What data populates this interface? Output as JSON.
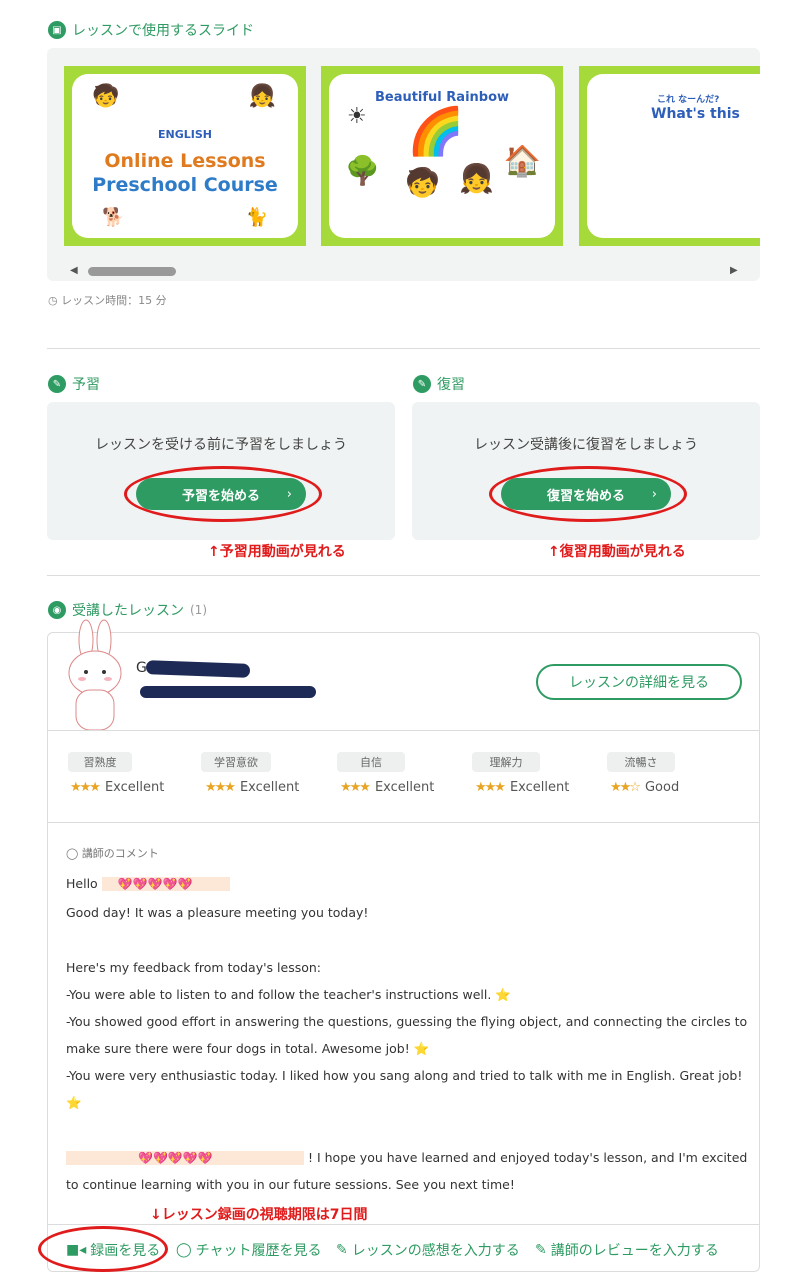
{
  "slides_section": {
    "title": "レッスンで使用するスライド",
    "slides": [
      {
        "line1": "ENGLISH",
        "line2": "Online Lessons",
        "line3": "Preschool Course"
      },
      {
        "line1": "Beautiful Rainbow"
      },
      {
        "line1": "これ なーんだ?",
        "line2": "What's this"
      }
    ],
    "lesson_time": "レッスン時間：15 分"
  },
  "preview": {
    "title": "予習",
    "message": "レッスンを受ける前に予習をしましょう",
    "button": "予習を始める",
    "annotation": "↑予習用動画が見れる"
  },
  "review": {
    "title": "復習",
    "message": "レッスン受講後に復習をしましょう",
    "button": "復習を始める",
    "annotation": "↑復習用動画が見れる"
  },
  "taken": {
    "title": "受講したレッスン",
    "count": "(1)",
    "teacher_initial": "G",
    "detail_button": "レッスンの詳細を見る",
    "metrics": [
      {
        "label": "習熟度",
        "stars": "★★★",
        "value": "Excellent"
      },
      {
        "label": "学習意欲",
        "stars": "★★★",
        "value": "Excellent"
      },
      {
        "label": "自信",
        "stars": "★★★",
        "value": "Excellent"
      },
      {
        "label": "理解力",
        "stars": "★★★",
        "value": "Excellent"
      },
      {
        "label": "流暢さ",
        "stars": "★★☆",
        "value": "Good"
      }
    ],
    "comment_header": "講師のコメント",
    "comment": {
      "hello": "Hello",
      "hearts": "💖💖💖💖💖",
      "line1": "Good day! It was a pleasure meeting you today!",
      "line2": "Here's my feedback from today's lesson:",
      "line3": "-You were able to listen to and follow the teacher's instructions well. ⭐",
      "line4a": "-You showed good effort in answering the questions, guessing the flying object, and connecting the circles to",
      "line4b": "make sure there were four dogs in total. Awesome job! ⭐",
      "line5a": "-You were very enthusiastic today. I liked how you sang along and tried to talk with me in English. Great job!",
      "line5b": "⭐",
      "line6a": "! I hope you have learned and enjoyed today's lesson, and I'm excited",
      "line6b": "to continue learning with you in our future sessions. See you next time!"
    },
    "recording_note": "↓レッスン録画の視聴期限は7日間",
    "actions": {
      "recording": "録画を見る",
      "chat": "チャット履歴を見る",
      "impression": "レッスンの感想を入力する",
      "teacher_review": "講師のレビューを入力する"
    }
  }
}
